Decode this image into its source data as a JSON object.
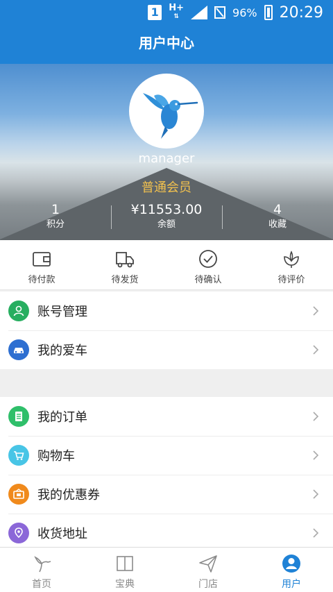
{
  "status_bar": {
    "sim_label": "1",
    "network_label": "H+",
    "battery_percent": "96%",
    "time": "20:29"
  },
  "header": {
    "title": "用户中心"
  },
  "profile": {
    "username": "manager",
    "member_level": "普通会员",
    "stats": [
      {
        "value": "1",
        "label": "积分"
      },
      {
        "value": "¥11553.00",
        "label": "余额"
      },
      {
        "value": "4",
        "label": "收藏"
      }
    ]
  },
  "order_status": [
    {
      "label": "待付款",
      "icon": "wallet-icon"
    },
    {
      "label": "待发货",
      "icon": "delivery-truck-icon"
    },
    {
      "label": "待确认",
      "icon": "check-circle-icon"
    },
    {
      "label": "待评价",
      "icon": "flower-icon"
    }
  ],
  "menu_group1": [
    {
      "label": "账号管理",
      "icon": "account-icon",
      "color": "#27ae60"
    },
    {
      "label": "我的爱车",
      "icon": "car-icon",
      "color": "#2e6fd1"
    }
  ],
  "menu_group2": [
    {
      "label": "我的订单",
      "icon": "order-list-icon",
      "color": "#2fbf6a"
    },
    {
      "label": "购物车",
      "icon": "cart-icon",
      "color": "#48c5e6"
    },
    {
      "label": "我的优惠券",
      "icon": "coupon-icon",
      "color": "#f08a1c"
    },
    {
      "label": "收货地址",
      "icon": "location-icon",
      "color": "#8b67d8"
    }
  ],
  "tabs": [
    {
      "label": "首页",
      "icon": "hummingbird-icon",
      "active": false
    },
    {
      "label": "宝典",
      "icon": "book-icon",
      "active": false
    },
    {
      "label": "门店",
      "icon": "paper-plane-icon",
      "active": false
    },
    {
      "label": "用户",
      "icon": "user-icon",
      "active": true
    }
  ],
  "colors": {
    "primary": "#1f82d6",
    "member_gold": "#f2c14e"
  }
}
